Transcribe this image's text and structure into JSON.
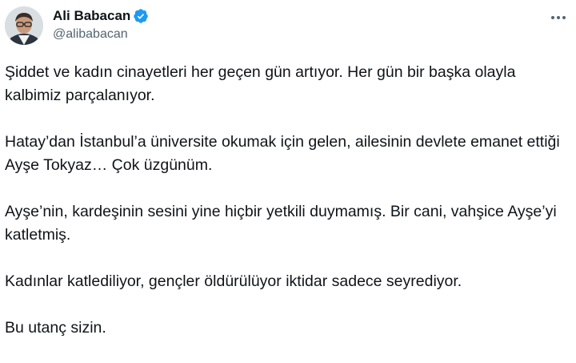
{
  "author": {
    "display_name": "Ali Babacan",
    "handle": "@alibabacan",
    "verified": true,
    "verified_color": "#1d9bf0"
  },
  "menu": {
    "icon": "more-horizontal-icon"
  },
  "tweet": {
    "paragraphs": [
      "Şiddet ve kadın cinayetleri her geçen gün artıyor. Her gün bir başka olayla kalbimiz parçalanıyor.",
      "Hatay’dan İstanbul’a üniversite okumak için gelen, ailesinin devlete emanet ettiği Ayşe Tokyaz… Çok üzgünüm.",
      "Ayşe’nin, kardeşinin sesini yine hiçbir yetkili duymamış. Bir cani, vahşice Ayşe’yi katletmiş.",
      "Kadınlar katlediliyor, gençler öldürülüyor iktidar sadece seyrediyor.",
      "Bu utanç sizin."
    ]
  }
}
